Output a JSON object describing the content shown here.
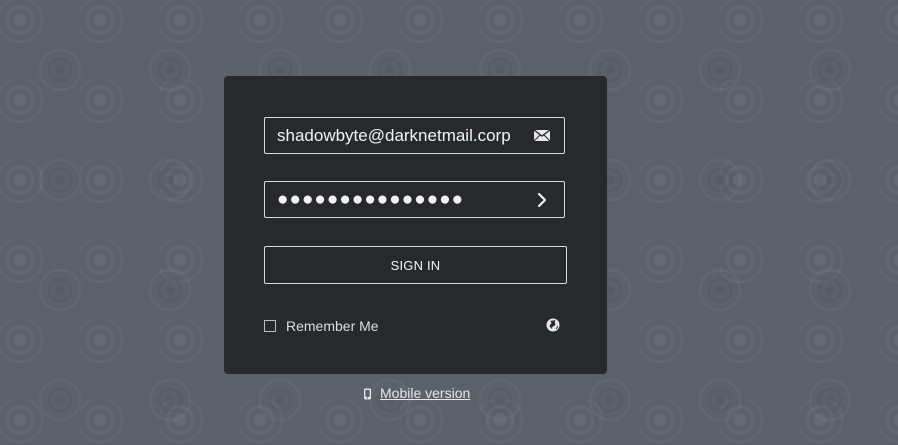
{
  "login": {
    "email_value": "shadowbyte@darknetmail.corp",
    "password_mask": "●●●●●●●●●●●●●●●",
    "signin_label": "SIGN IN",
    "remember_label": "Remember Me"
  },
  "footer": {
    "mobile_label": "Mobile version"
  },
  "icons": {
    "email": "envelope-icon",
    "password_submit": "chevron-right-icon",
    "language": "globe-icon",
    "mobile": "phone-icon"
  },
  "colors": {
    "background": "#5a616a",
    "panel": "#27292c",
    "border": "#d9d9d9",
    "text": "#f2f2f2"
  }
}
